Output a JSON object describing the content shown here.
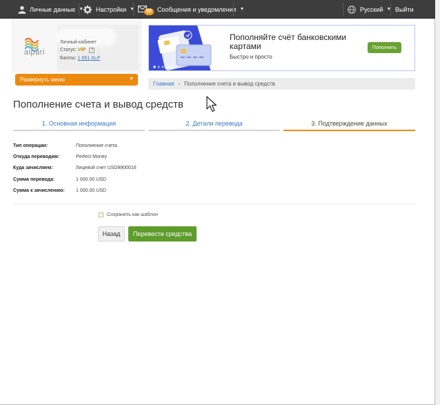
{
  "topbar": {
    "personal_label": "Личные данные",
    "settings_label": "Настройки",
    "messages_label": "Сообщения и уведомления",
    "messages_count": "50",
    "language_label": "Русский",
    "logout_label": "Выйти"
  },
  "user_card": {
    "logo_text": "alpari",
    "cabinet_label": "Личный кабинет",
    "status_label": "Статус:",
    "status_value": "VIP",
    "help_mark": "?",
    "points_label": "Баллы:",
    "points_value": "1 661 ALP",
    "expand_menu": "Развернуть меню"
  },
  "banner": {
    "title": "Пополняйте счёт банковскими картами",
    "subtitle": "Быстро и просто",
    "button": "Пополнить"
  },
  "breadcrumb": {
    "home": "Главная",
    "current": "Пополнение счета и вывод средств"
  },
  "page_title": "Пополнение счета и вывод средств",
  "steps": [
    {
      "label": "1. Основная информация",
      "active": false
    },
    {
      "label": "2. Детали перевода",
      "active": false
    },
    {
      "label": "3. Подтверждение данных",
      "active": true
    }
  ],
  "details": [
    {
      "key": "Тип операции:",
      "value": "Пополнение счета"
    },
    {
      "key": "Откуда переводим:",
      "value": "Perfect Money"
    },
    {
      "key": "Куда зачисляем:",
      "value": "Лицевой счет USD9900016"
    },
    {
      "key": "Сумма перевода:",
      "value": "1 000.00 USD"
    },
    {
      "key": "Сумма к зачислению:",
      "value": "1 000.00 USD"
    }
  ],
  "save_template": "Сохранить как шаблон",
  "buttons": {
    "back": "Назад",
    "submit": "Перевести средства"
  },
  "colors": {
    "accent_orange": "#ec8a10",
    "accent_green": "#5e9c2b",
    "link_blue": "#3a78c2",
    "topbar": "#3d3d3d"
  }
}
